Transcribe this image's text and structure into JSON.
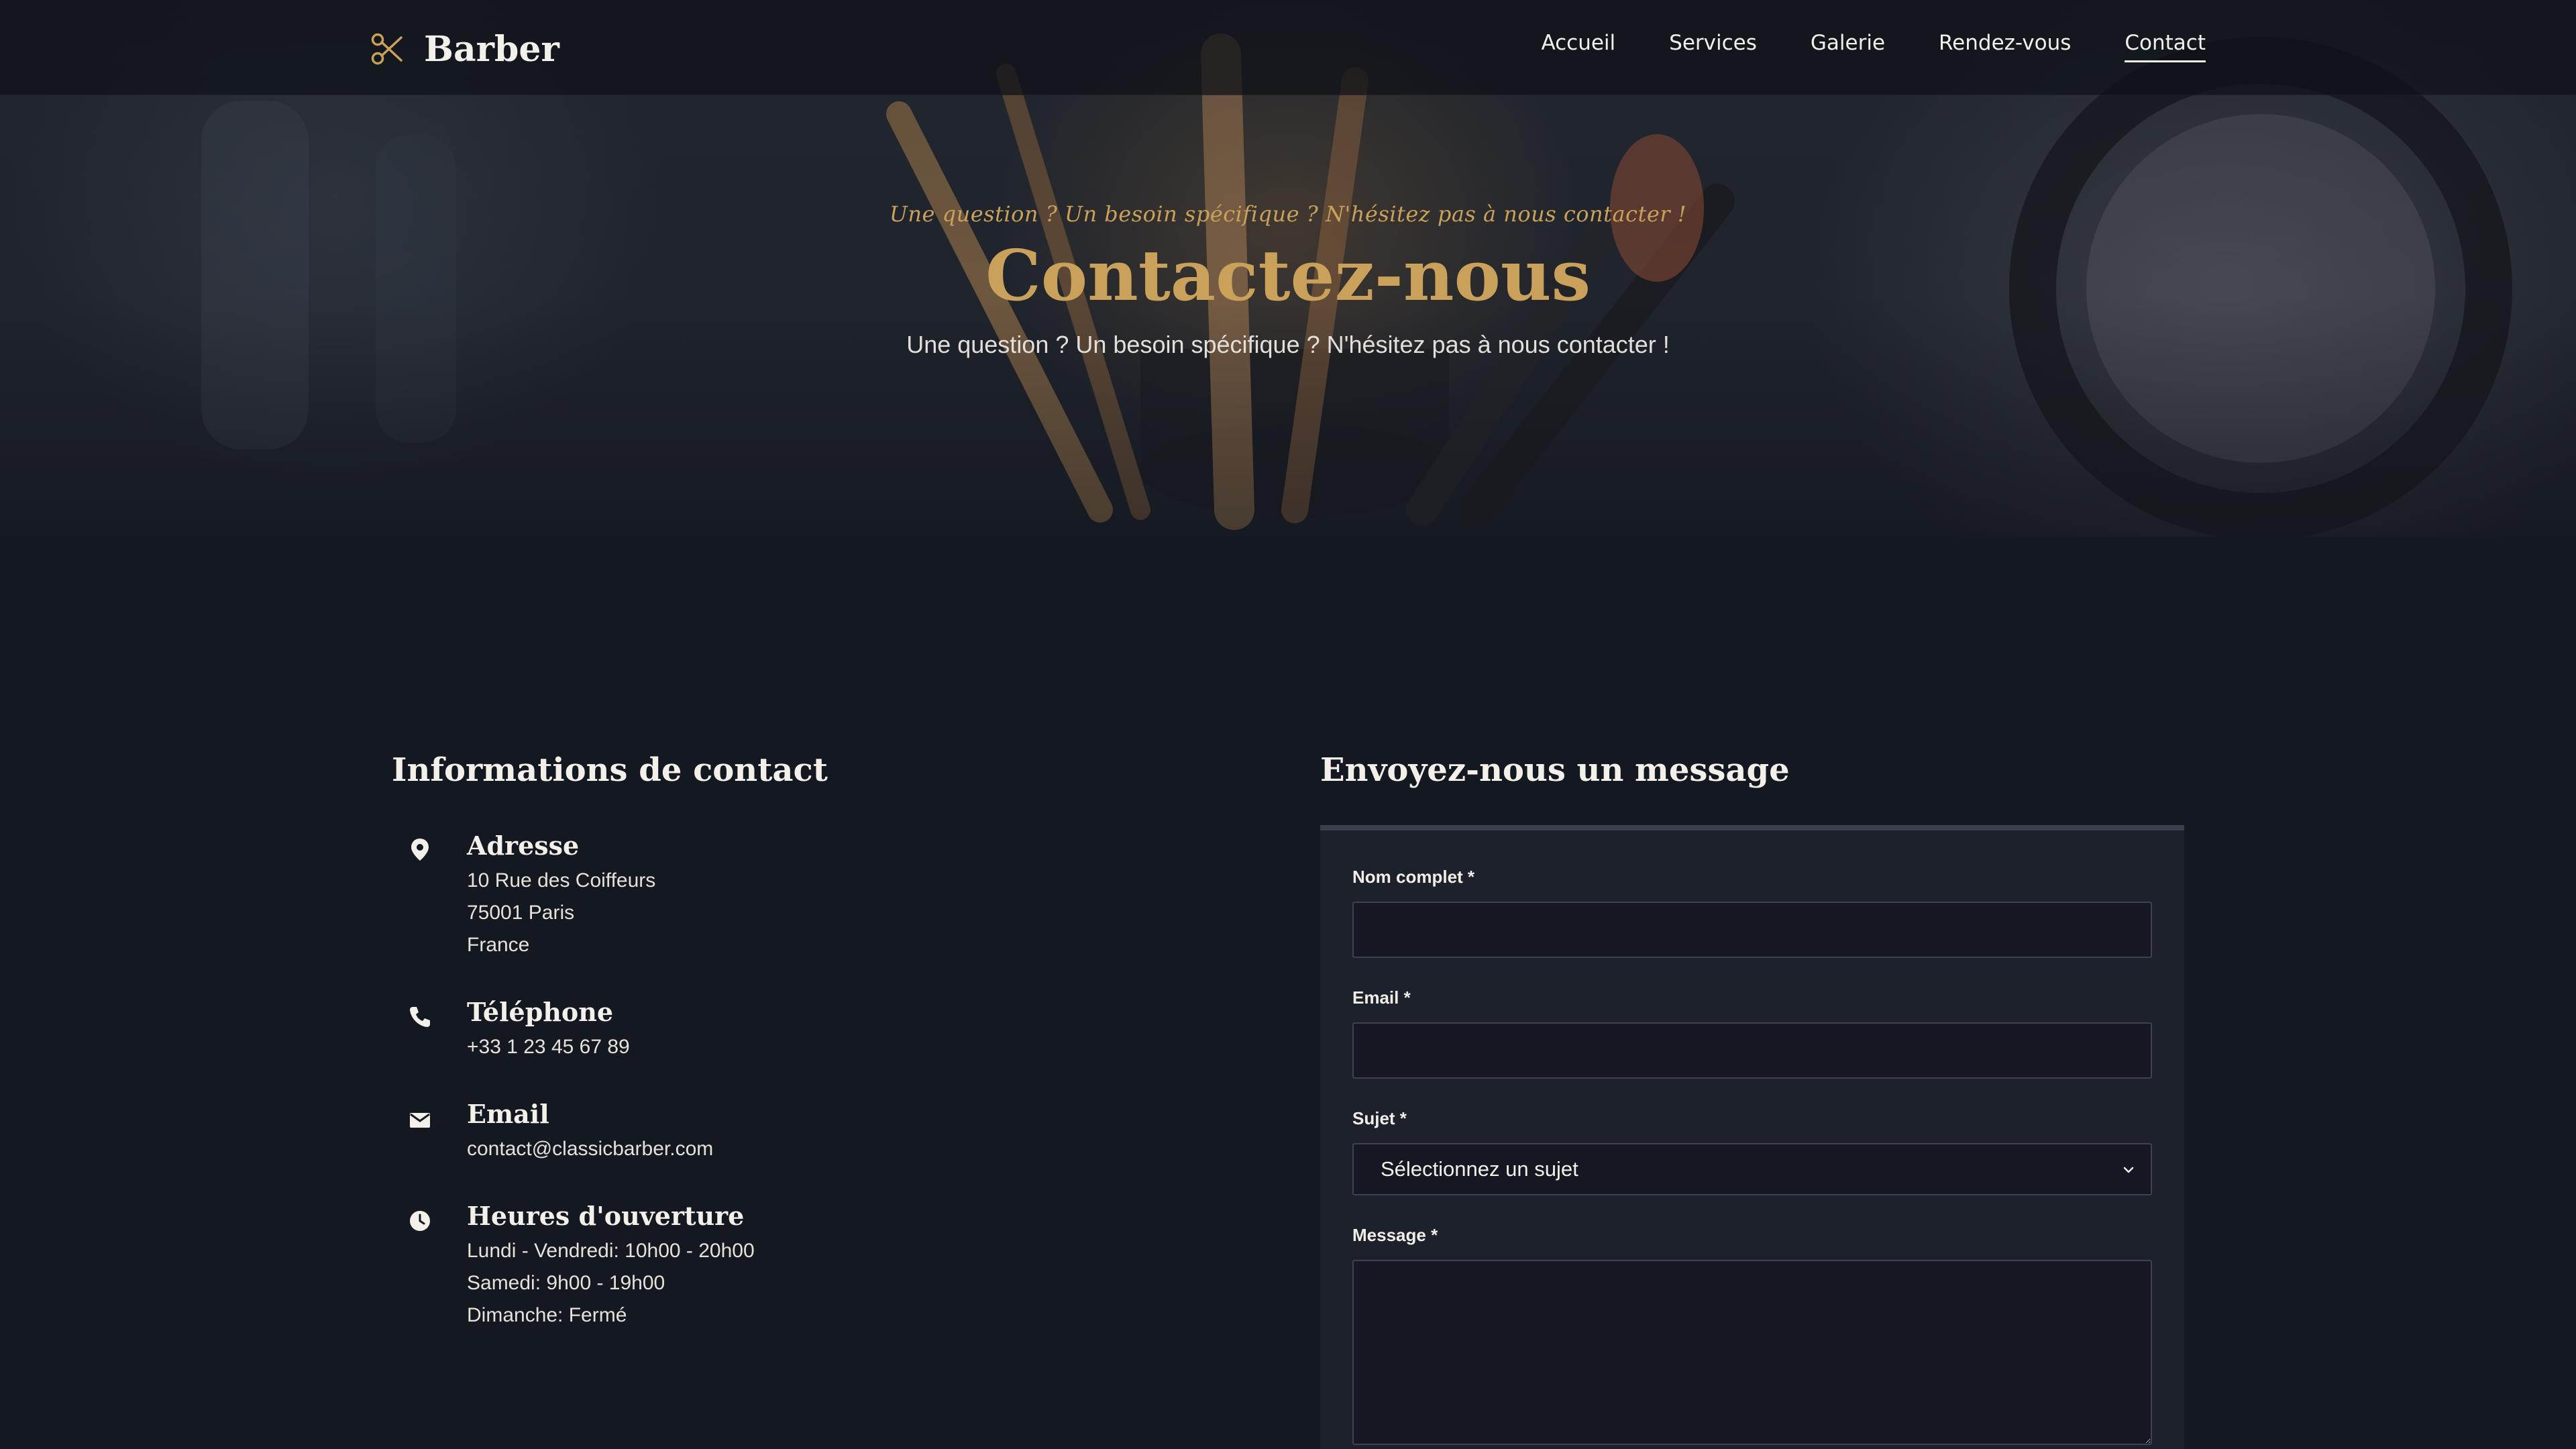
{
  "colors": {
    "accent_gold": "#c9a15a",
    "page_background": "#141821",
    "card_background": "#1d212c",
    "input_background": "#151822",
    "text_light": "#f3f0ea"
  },
  "navbar": {
    "brand_icon": "scissors-icon",
    "brand_name": "Barber",
    "links": [
      {
        "label": "Accueil",
        "active": false
      },
      {
        "label": "Services",
        "active": false
      },
      {
        "label": "Galerie",
        "active": false
      },
      {
        "label": "Rendez-vous",
        "active": false
      },
      {
        "label": "Contact",
        "active": true
      }
    ]
  },
  "hero": {
    "tagline": "Une question ? Un besoin spécifique ? N'hésitez pas à nous contacter !",
    "title": "Contactez-nous",
    "subtitle": "Une question ? Un besoin spécifique ? N'hésitez pas à nous contacter !"
  },
  "contact_info": {
    "title": "Informations de contact",
    "address": {
      "icon": "map-pin-icon",
      "heading": "Adresse",
      "lines": [
        "10 Rue des Coiffeurs",
        "75001 Paris",
        "France"
      ]
    },
    "phone": {
      "icon": "phone-icon",
      "heading": "Téléphone",
      "lines": [
        "+33 1 23 45 67 89"
      ]
    },
    "email": {
      "icon": "mail-icon",
      "heading": "Email",
      "lines": [
        "contact@classicbarber.com"
      ]
    },
    "hours": {
      "icon": "clock-icon",
      "heading": "Heures d'ouverture",
      "lines": [
        "Lundi - Vendredi: 10h00 - 20h00",
        "Samedi: 9h00 - 19h00",
        "Dimanche: Fermé"
      ]
    }
  },
  "form": {
    "title": "Envoyez-nous un message",
    "name_label": "Nom complet *",
    "name_value": "",
    "email_label": "Email *",
    "email_value": "",
    "subject_label": "Sujet *",
    "subject_selected": "Sélectionnez un sujet",
    "message_label": "Message *",
    "message_value": ""
  }
}
